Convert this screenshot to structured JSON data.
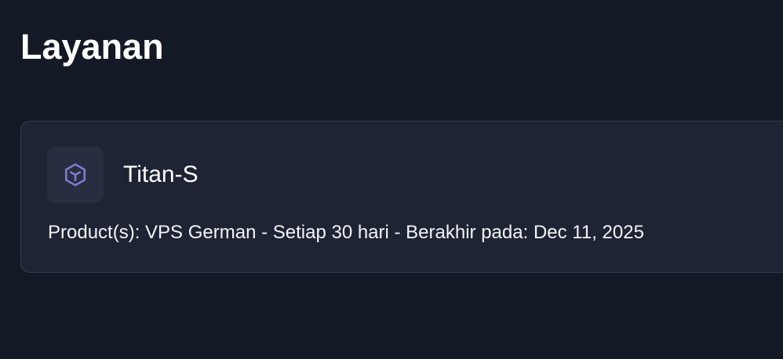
{
  "page": {
    "title": "Layanan"
  },
  "service": {
    "icon": "cube-icon",
    "icon_color": "#7f7bd1",
    "name": "Titan-S",
    "details": "Product(s): VPS German - Setiap 30 hari - Berakhir pada: Dec 11, 2025"
  },
  "colors": {
    "background": "#141926",
    "card_background": "#1e2433",
    "card_border": "#343c4e",
    "icon_background": "#272e3f"
  }
}
